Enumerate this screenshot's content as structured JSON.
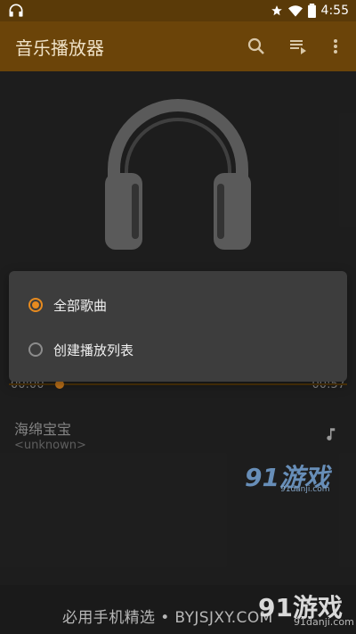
{
  "status_bar": {
    "time": "4:55",
    "icons": [
      "headphones-icon",
      "star-icon",
      "wifi-icon",
      "battery-icon"
    ]
  },
  "app_bar": {
    "title": "音乐播放器",
    "icons": [
      "search-icon",
      "queue-music-icon",
      "more-vert-icon"
    ]
  },
  "player": {
    "elapsed": "00:00",
    "duration": "00:57",
    "progress_fraction": 0.15,
    "song_title": "海绵宝宝",
    "artist": "<unknown>"
  },
  "dialog": {
    "options": [
      {
        "label": "全部歌曲",
        "selected": true
      },
      {
        "label": "创建播放列表",
        "selected": false
      }
    ]
  },
  "watermarks": {
    "mid_logo": "91游戏",
    "mid_logo_sub": "91danji.com",
    "bottom_text": "必用手机精选 • BYJSJXY.COM",
    "bottom_logo": "91游戏",
    "bottom_logo_sub": "91danji.com"
  },
  "colors": {
    "accent": "#e68a1f",
    "app_bar": "#6b4409",
    "background": "#232323"
  }
}
